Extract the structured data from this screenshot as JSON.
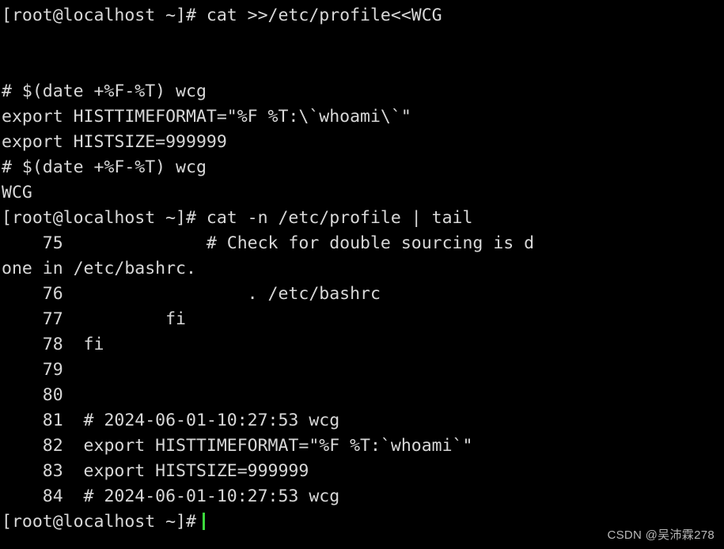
{
  "terminal": {
    "window_title": "Terminal",
    "background_color": "#000000",
    "foreground_color": "#d8d8d8",
    "cursor_color": "#3cdb3c",
    "font_size_px": 21.5,
    "line_height_px": 32,
    "prompt": "[root@localhost ~]#",
    "user": "root",
    "hostname": "localhost",
    "cwd_short": "~",
    "lines": [
      {
        "id": "cmd-1",
        "text": "[root@localhost ~]# cat >>/etc/profile<<WCG",
        "kind": "command"
      },
      {
        "id": "blank-1",
        "text": "",
        "kind": "blank"
      },
      {
        "id": "blank-2",
        "text": "",
        "kind": "blank"
      },
      {
        "id": "heredoc-1",
        "text": "# $(date +%F-%T) wcg",
        "kind": "heredoc-input"
      },
      {
        "id": "heredoc-2",
        "text": "export HISTTIMEFORMAT=\"%F %T:\\`whoami\\`\"",
        "kind": "heredoc-input"
      },
      {
        "id": "heredoc-3",
        "text": "export HISTSIZE=999999",
        "kind": "heredoc-input"
      },
      {
        "id": "heredoc-4",
        "text": "# $(date +%F-%T) wcg",
        "kind": "heredoc-input"
      },
      {
        "id": "heredoc-end",
        "text": "WCG",
        "kind": "heredoc-delimiter"
      },
      {
        "id": "cmd-2",
        "text": "[root@localhost ~]# cat -n /etc/profile | tail",
        "kind": "command"
      },
      {
        "id": "out-75a",
        "text": "    75              # Check for double sourcing is d",
        "kind": "output"
      },
      {
        "id": "out-75b",
        "text": "one in /etc/bashrc.",
        "kind": "output-wrapped"
      },
      {
        "id": "out-76",
        "text": "    76                  . /etc/bashrc",
        "kind": "output"
      },
      {
        "id": "out-77",
        "text": "    77          fi",
        "kind": "output"
      },
      {
        "id": "out-78",
        "text": "    78  fi",
        "kind": "output"
      },
      {
        "id": "out-79",
        "text": "    79",
        "kind": "output"
      },
      {
        "id": "out-80",
        "text": "    80",
        "kind": "output"
      },
      {
        "id": "out-81",
        "text": "    81  # 2024-06-01-10:27:53 wcg",
        "kind": "output"
      },
      {
        "id": "out-82",
        "text": "    82  export HISTTIMEFORMAT=\"%F %T:`whoami`\"",
        "kind": "output"
      },
      {
        "id": "out-83",
        "text": "    83  export HISTSIZE=999999",
        "kind": "output"
      },
      {
        "id": "out-84",
        "text": "    84  # 2024-06-01-10:27:53 wcg",
        "kind": "output"
      }
    ],
    "final_prompt": "[root@localhost ~]#",
    "commands_entered": [
      "cat >>/etc/profile<<WCG",
      "cat -n /etc/profile | tail"
    ],
    "file_line_numbers": [
      75,
      76,
      77,
      78,
      79,
      80,
      81,
      82,
      83,
      84
    ],
    "target_file": "/etc/profile"
  },
  "watermark": {
    "text": "CSDN @吴沛霖278",
    "color": "#b9b9b9"
  }
}
